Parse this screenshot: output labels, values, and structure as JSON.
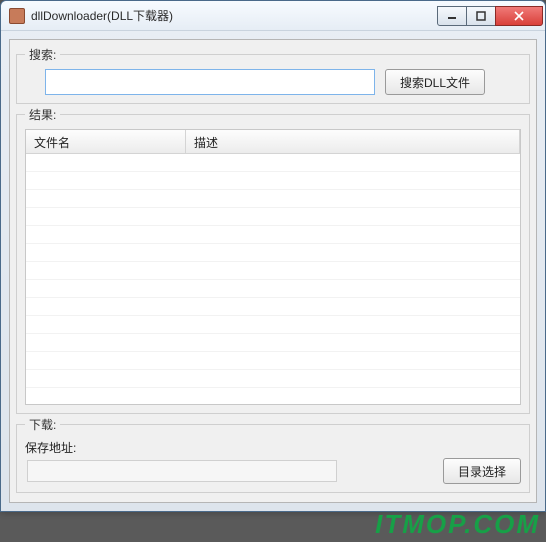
{
  "window": {
    "title": "dllDownloader(DLL下载器)"
  },
  "search": {
    "legend": "搜索:",
    "input_value": "",
    "input_placeholder": "",
    "button_label": "搜索DLL文件"
  },
  "results": {
    "legend": "结果:",
    "columns": [
      "文件名",
      "描述"
    ],
    "rows": []
  },
  "download": {
    "legend": "下载:",
    "path_label": "保存地址:",
    "path_value": "",
    "browse_label": "目录选择"
  },
  "watermark": "ITMOP.COM"
}
